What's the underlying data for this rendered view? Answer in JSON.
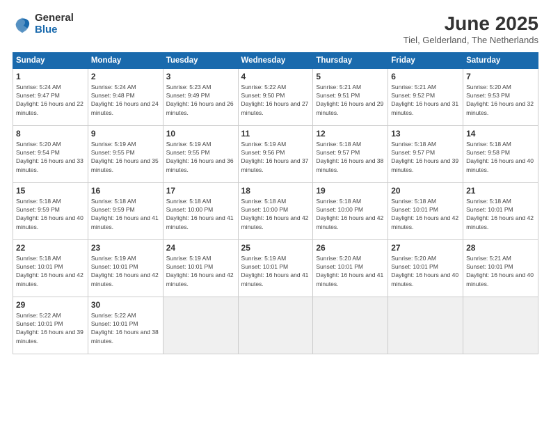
{
  "header": {
    "logo_general": "General",
    "logo_blue": "Blue",
    "month_title": "June 2025",
    "location": "Tiel, Gelderland, The Netherlands"
  },
  "weekdays": [
    "Sunday",
    "Monday",
    "Tuesday",
    "Wednesday",
    "Thursday",
    "Friday",
    "Saturday"
  ],
  "weeks": [
    [
      {
        "day": "1",
        "rise": "Sunrise: 5:24 AM",
        "set": "Sunset: 9:47 PM",
        "daylight": "Daylight: 16 hours and 22 minutes."
      },
      {
        "day": "2",
        "rise": "Sunrise: 5:24 AM",
        "set": "Sunset: 9:48 PM",
        "daylight": "Daylight: 16 hours and 24 minutes."
      },
      {
        "day": "3",
        "rise": "Sunrise: 5:23 AM",
        "set": "Sunset: 9:49 PM",
        "daylight": "Daylight: 16 hours and 26 minutes."
      },
      {
        "day": "4",
        "rise": "Sunrise: 5:22 AM",
        "set": "Sunset: 9:50 PM",
        "daylight": "Daylight: 16 hours and 27 minutes."
      },
      {
        "day": "5",
        "rise": "Sunrise: 5:21 AM",
        "set": "Sunset: 9:51 PM",
        "daylight": "Daylight: 16 hours and 29 minutes."
      },
      {
        "day": "6",
        "rise": "Sunrise: 5:21 AM",
        "set": "Sunset: 9:52 PM",
        "daylight": "Daylight: 16 hours and 31 minutes."
      },
      {
        "day": "7",
        "rise": "Sunrise: 5:20 AM",
        "set": "Sunset: 9:53 PM",
        "daylight": "Daylight: 16 hours and 32 minutes."
      }
    ],
    [
      {
        "day": "8",
        "rise": "Sunrise: 5:20 AM",
        "set": "Sunset: 9:54 PM",
        "daylight": "Daylight: 16 hours and 33 minutes."
      },
      {
        "day": "9",
        "rise": "Sunrise: 5:19 AM",
        "set": "Sunset: 9:55 PM",
        "daylight": "Daylight: 16 hours and 35 minutes."
      },
      {
        "day": "10",
        "rise": "Sunrise: 5:19 AM",
        "set": "Sunset: 9:55 PM",
        "daylight": "Daylight: 16 hours and 36 minutes."
      },
      {
        "day": "11",
        "rise": "Sunrise: 5:19 AM",
        "set": "Sunset: 9:56 PM",
        "daylight": "Daylight: 16 hours and 37 minutes."
      },
      {
        "day": "12",
        "rise": "Sunrise: 5:18 AM",
        "set": "Sunset: 9:57 PM",
        "daylight": "Daylight: 16 hours and 38 minutes."
      },
      {
        "day": "13",
        "rise": "Sunrise: 5:18 AM",
        "set": "Sunset: 9:57 PM",
        "daylight": "Daylight: 16 hours and 39 minutes."
      },
      {
        "day": "14",
        "rise": "Sunrise: 5:18 AM",
        "set": "Sunset: 9:58 PM",
        "daylight": "Daylight: 16 hours and 40 minutes."
      }
    ],
    [
      {
        "day": "15",
        "rise": "Sunrise: 5:18 AM",
        "set": "Sunset: 9:59 PM",
        "daylight": "Daylight: 16 hours and 40 minutes."
      },
      {
        "day": "16",
        "rise": "Sunrise: 5:18 AM",
        "set": "Sunset: 9:59 PM",
        "daylight": "Daylight: 16 hours and 41 minutes."
      },
      {
        "day": "17",
        "rise": "Sunrise: 5:18 AM",
        "set": "Sunset: 10:00 PM",
        "daylight": "Daylight: 16 hours and 41 minutes."
      },
      {
        "day": "18",
        "rise": "Sunrise: 5:18 AM",
        "set": "Sunset: 10:00 PM",
        "daylight": "Daylight: 16 hours and 42 minutes."
      },
      {
        "day": "19",
        "rise": "Sunrise: 5:18 AM",
        "set": "Sunset: 10:00 PM",
        "daylight": "Daylight: 16 hours and 42 minutes."
      },
      {
        "day": "20",
        "rise": "Sunrise: 5:18 AM",
        "set": "Sunset: 10:01 PM",
        "daylight": "Daylight: 16 hours and 42 minutes."
      },
      {
        "day": "21",
        "rise": "Sunrise: 5:18 AM",
        "set": "Sunset: 10:01 PM",
        "daylight": "Daylight: 16 hours and 42 minutes."
      }
    ],
    [
      {
        "day": "22",
        "rise": "Sunrise: 5:18 AM",
        "set": "Sunset: 10:01 PM",
        "daylight": "Daylight: 16 hours and 42 minutes."
      },
      {
        "day": "23",
        "rise": "Sunrise: 5:19 AM",
        "set": "Sunset: 10:01 PM",
        "daylight": "Daylight: 16 hours and 42 minutes."
      },
      {
        "day": "24",
        "rise": "Sunrise: 5:19 AM",
        "set": "Sunset: 10:01 PM",
        "daylight": "Daylight: 16 hours and 42 minutes."
      },
      {
        "day": "25",
        "rise": "Sunrise: 5:19 AM",
        "set": "Sunset: 10:01 PM",
        "daylight": "Daylight: 16 hours and 41 minutes."
      },
      {
        "day": "26",
        "rise": "Sunrise: 5:20 AM",
        "set": "Sunset: 10:01 PM",
        "daylight": "Daylight: 16 hours and 41 minutes."
      },
      {
        "day": "27",
        "rise": "Sunrise: 5:20 AM",
        "set": "Sunset: 10:01 PM",
        "daylight": "Daylight: 16 hours and 40 minutes."
      },
      {
        "day": "28",
        "rise": "Sunrise: 5:21 AM",
        "set": "Sunset: 10:01 PM",
        "daylight": "Daylight: 16 hours and 40 minutes."
      }
    ],
    [
      {
        "day": "29",
        "rise": "Sunrise: 5:22 AM",
        "set": "Sunset: 10:01 PM",
        "daylight": "Daylight: 16 hours and 39 minutes."
      },
      {
        "day": "30",
        "rise": "Sunrise: 5:22 AM",
        "set": "Sunset: 10:01 PM",
        "daylight": "Daylight: 16 hours and 38 minutes."
      },
      {
        "day": "",
        "rise": "",
        "set": "",
        "daylight": ""
      },
      {
        "day": "",
        "rise": "",
        "set": "",
        "daylight": ""
      },
      {
        "day": "",
        "rise": "",
        "set": "",
        "daylight": ""
      },
      {
        "day": "",
        "rise": "",
        "set": "",
        "daylight": ""
      },
      {
        "day": "",
        "rise": "",
        "set": "",
        "daylight": ""
      }
    ]
  ]
}
